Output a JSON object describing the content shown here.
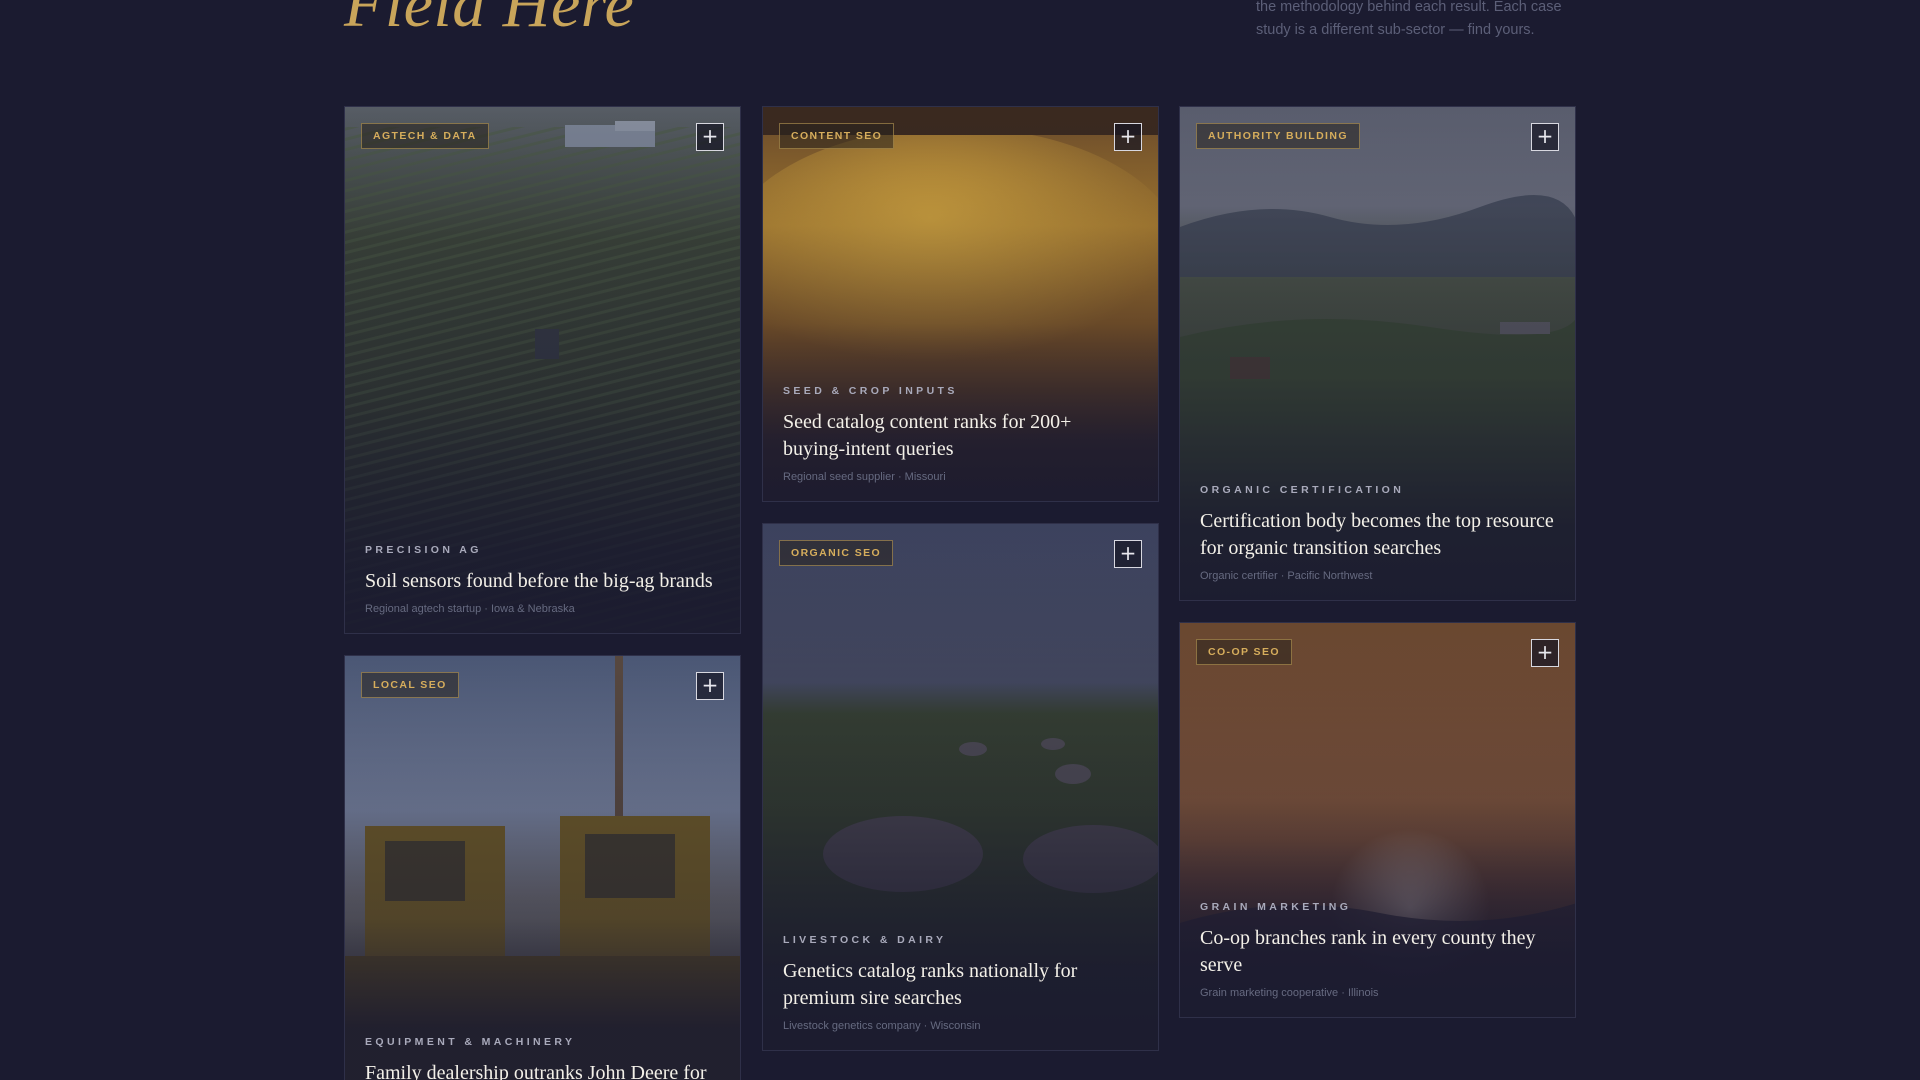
{
  "header": {
    "heading": "Field Here",
    "intro": "the methodology behind each result. Each case study is a different sub-sector — find yours."
  },
  "cards": [
    {
      "badge": "AGTECH & DATA",
      "kicker": "PRECISION AG",
      "title": "Soil sensors found before the big-ag brands",
      "meta": "Regional agtech startup · Iowa & Nebraska"
    },
    {
      "badge": "CONTENT SEO",
      "kicker": "SEED & CROP INPUTS",
      "title": "Seed catalog content ranks for 200+ buying-intent queries",
      "meta": "Regional seed supplier · Missouri"
    },
    {
      "badge": "AUTHORITY BUILDING",
      "kicker": "ORGANIC CERTIFICATION",
      "title": "Certification body becomes the top resource for organic transition searches",
      "meta": "Organic certifier · Pacific Northwest"
    },
    {
      "badge": "LOCAL SEO",
      "kicker": "EQUIPMENT & MACHINERY",
      "title": "Family dealership outranks John Deere for",
      "meta": ""
    },
    {
      "badge": "ORGANIC SEO",
      "kicker": "LIVESTOCK & DAIRY",
      "title": "Genetics catalog ranks nationally for premium sire searches",
      "meta": "Livestock genetics company · Wisconsin"
    },
    {
      "badge": "CO-OP SEO",
      "kicker": "GRAIN MARKETING",
      "title": "Co-op branches rank in every county they serve",
      "meta": "Grain marketing cooperative · Illinois"
    }
  ],
  "expand_symbol": "+",
  "colors": {
    "background": "#1b1b30",
    "accent": "#c9a55a",
    "card_border": "#2f3049"
  }
}
